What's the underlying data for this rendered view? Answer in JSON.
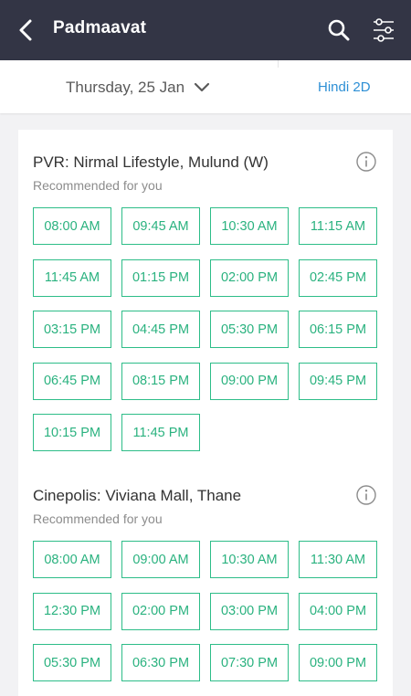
{
  "header": {
    "title": "Padmaavat",
    "icons": {
      "back": "back-arrow-icon",
      "search": "search-icon",
      "filter": "filter-sliders-icon"
    }
  },
  "subheader": {
    "date": "Thursday, 25 Jan",
    "format": "Hindi 2D"
  },
  "colors": {
    "header_bg": "#333545",
    "showtime_green": "#2dbd88",
    "link_blue": "#2d8fd5"
  },
  "venues": [
    {
      "name": "PVR: Nirmal Lifestyle, Mulund (W)",
      "subtitle": "Recommended for you",
      "showtimes": [
        "08:00 AM",
        "09:45 AM",
        "10:30 AM",
        "11:15 AM",
        "11:45 AM",
        "01:15 PM",
        "02:00 PM",
        "02:45 PM",
        "03:15 PM",
        "04:45 PM",
        "05:30 PM",
        "06:15 PM",
        "06:45 PM",
        "08:15 PM",
        "09:00 PM",
        "09:45 PM",
        "10:15 PM",
        "11:45 PM"
      ]
    },
    {
      "name": "Cinepolis: Viviana Mall, Thane",
      "subtitle": "Recommended for you",
      "showtimes": [
        "08:00 AM",
        "09:00 AM",
        "10:30 AM",
        "11:30 AM",
        "12:30 PM",
        "02:00 PM",
        "03:00 PM",
        "04:00 PM",
        "05:30 PM",
        "06:30 PM",
        "07:30 PM",
        "09:00 PM"
      ]
    }
  ]
}
